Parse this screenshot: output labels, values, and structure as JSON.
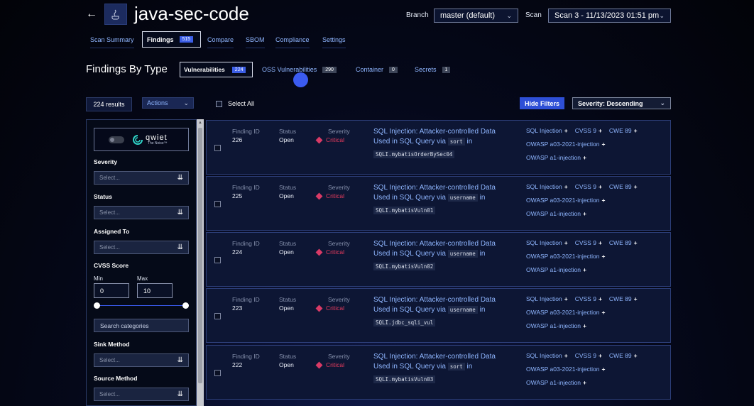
{
  "header": {
    "project_title": "java-sec-code",
    "branch_label": "Branch",
    "branch_value": "master (default)",
    "scan_label": "Scan",
    "scan_value": "Scan 3 - 11/13/2023 01:51 pm"
  },
  "nav": {
    "tabs": [
      {
        "label": "Scan Summary"
      },
      {
        "label": "Findings",
        "badge": "515"
      },
      {
        "label": "Compare"
      },
      {
        "label": "SBOM"
      },
      {
        "label": "Compliance"
      },
      {
        "label": "Settings"
      }
    ]
  },
  "findings_by_type": {
    "title": "Findings By Type",
    "tabs": [
      {
        "label": "Vulnerabilities",
        "count": "224"
      },
      {
        "label": "OSS Vulnerabilities",
        "count": "290"
      },
      {
        "label": "Container",
        "count": "0"
      },
      {
        "label": "Secrets",
        "count": "1"
      }
    ]
  },
  "toolbar": {
    "results": "224 results",
    "actions_label": "Actions",
    "select_all_label": "Select All",
    "hide_filters_label": "Hide Filters",
    "sort_value": "Severity: Descending"
  },
  "sidebar": {
    "logo_word": "qwiet",
    "logo_sub": "The Noise™",
    "filters": [
      {
        "label": "Severity",
        "placeholder": "Select..."
      },
      {
        "label": "Status",
        "placeholder": "Select..."
      },
      {
        "label": "Assigned To",
        "placeholder": "Select..."
      }
    ],
    "cvss": {
      "label": "CVSS Score",
      "min_label": "Min",
      "max_label": "Max",
      "min_value": "0",
      "max_value": "10"
    },
    "search_placeholder": "Search categories",
    "sink_label": "Sink Method",
    "sink_placeholder": "Select...",
    "source_label": "Source Method",
    "source_placeholder": "Select..."
  },
  "labels": {
    "finding_id": "Finding ID",
    "status": "Status",
    "severity": "Severity"
  },
  "findings": [
    {
      "id": "226",
      "status": "Open",
      "severity": "Critical",
      "title_a": "SQL Injection: Attacker-controlled Data",
      "title_b": "Used in SQL Query via",
      "param": "sort",
      "in": "in",
      "method": "SQLI.mybatisOrderBySec04"
    },
    {
      "id": "225",
      "status": "Open",
      "severity": "Critical",
      "title_a": "SQL Injection: Attacker-controlled Data",
      "title_b": "Used in SQL Query via",
      "param": "username",
      "in": "in",
      "method": "SQLI.mybatisVuln01"
    },
    {
      "id": "224",
      "status": "Open",
      "severity": "Critical",
      "title_a": "SQL Injection: Attacker-controlled Data",
      "title_b": "Used in SQL Query via",
      "param": "username",
      "in": "in",
      "method": "SQLI.mybatisVuln02"
    },
    {
      "id": "223",
      "status": "Open",
      "severity": "Critical",
      "title_a": "SQL Injection: Attacker-controlled Data",
      "title_b": "Used in SQL Query via",
      "param": "username",
      "in": "in",
      "method": "SQLI.jdbc_sqli_vul"
    },
    {
      "id": "222",
      "status": "Open",
      "severity": "Critical",
      "title_a": "SQL Injection: Attacker-controlled Data",
      "title_b": "Used in SQL Query via",
      "param": "sort",
      "in": "in",
      "method": "SQLI.mybatisVuln03"
    }
  ],
  "tags": {
    "sql_injection": "SQL Injection",
    "cvss": "CVSS 9",
    "cwe": "CWE 89",
    "owasp_a03": "OWASP a03-2021-injection",
    "owasp_a1": "OWASP a1-injection",
    "plus": "+"
  },
  "colors": {
    "accent": "#3b5bf0",
    "link": "#8fb6ff",
    "critical": "#e23a5c",
    "card_bg": "#0d1634"
  }
}
